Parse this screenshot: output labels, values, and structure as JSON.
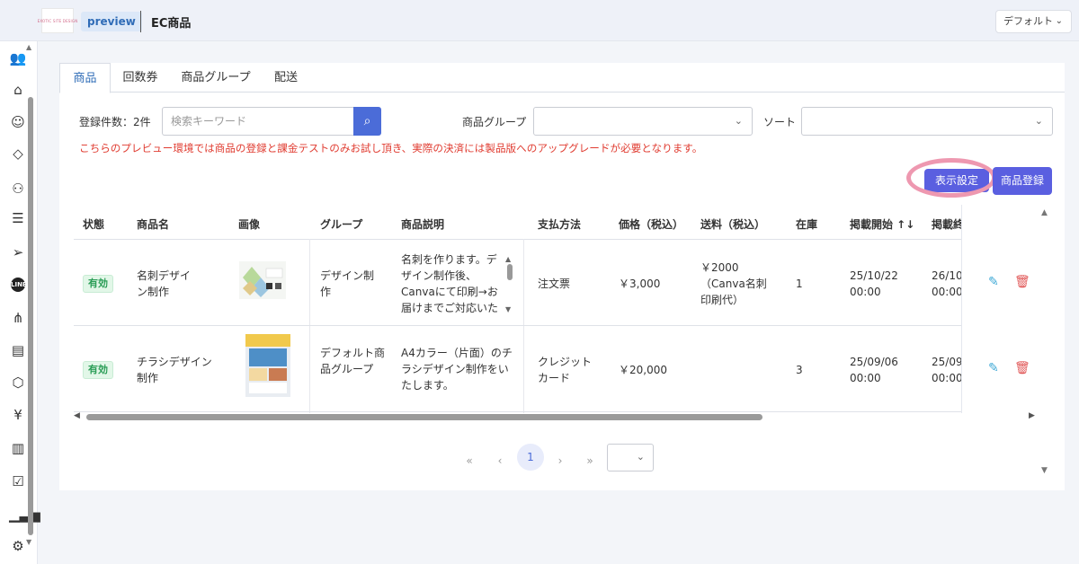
{
  "header": {
    "logo_text": "EXOTIC SITE DESIGN",
    "badge": "preview",
    "title": "EC商品",
    "view_select": "デフォルト",
    "view_select_icon": "chevron-down-icon"
  },
  "sidebar": {
    "icons": [
      "users-icon",
      "tag-icon",
      "smile-icon",
      "ticket-icon",
      "person-settings-icon",
      "list-icon",
      "send-icon",
      "line-icon",
      "org-chart-icon",
      "document-icon",
      "box-icon",
      "yen-icon",
      "store-icon",
      "calendar-check-icon",
      "bar-chart-icon",
      "gear-icon"
    ],
    "line_label": "LINE",
    "yen_glyph": "¥"
  },
  "tabs": [
    "商品",
    "回数券",
    "商品グループ",
    "配送"
  ],
  "toolbar": {
    "count_label": "登録件数：2件",
    "search_placeholder": "検索キーワード",
    "group_label": "商品グループ",
    "sort_label": "ソート",
    "notice": "こちらのプレビュー環境では商品の登録と課金テストのみお試し頂き、実際の決済には製品版へのアップグレードが必要となります。",
    "display_settings": "表示設定",
    "register": "商品登録"
  },
  "table": {
    "headers": [
      "状態",
      "商品名",
      "画像",
      "グループ",
      "商品説明",
      "支払方法",
      "価格（税込）",
      "送料（税込）",
      "在庫",
      "掲載開始 ↑↓",
      "掲載終"
    ],
    "rows": [
      {
        "status": "有効",
        "name": "名刺デザイン制作",
        "group": "デザイン制作",
        "description": "名刺を作ります。デザイン制作後、Canvaにて印刷→お届けまでご対応いた",
        "payment": "注文票",
        "price": "￥3,000",
        "shipping": "￥2000（Canva名刺印刷代）",
        "stock": "1",
        "start": "25/10/22 00:00",
        "end": "26/10 00:00"
      },
      {
        "status": "有効",
        "name": "チラシデザイン制作",
        "group": "デフォルト商品グループ",
        "description": "A4カラー（片面）のチラシデザイン制作をいたします。",
        "payment": "クレジットカード",
        "price": "￥20,000",
        "shipping": "",
        "stock": "3",
        "start": "25/09/06 00:00",
        "end": "25/09 00:00"
      }
    ]
  },
  "pagination": {
    "first": "«",
    "prev": "‹",
    "current": "1",
    "next": "›",
    "last": "»"
  },
  "colors": {
    "primary": "#5a5fe0",
    "notice": "#e03c31",
    "status_bg": "#e2f7e8",
    "highlight_ring": "#ee98b0"
  }
}
